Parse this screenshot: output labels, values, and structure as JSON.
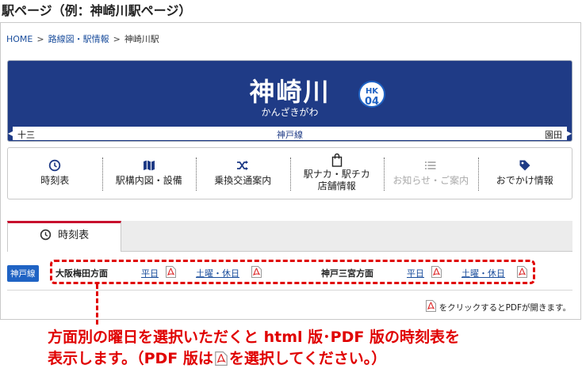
{
  "heading": "駅ページ（例：神崎川駅ページ）",
  "breadcrumb": {
    "home": "HOME",
    "sep": ">",
    "routes": "路線図・駅情報",
    "current": "神崎川駅"
  },
  "station": {
    "name": "神崎川",
    "kana": "かんざきがわ",
    "code_line": "HK",
    "code_num": "04",
    "prev": "十三",
    "line": "神戸線",
    "next": "園田"
  },
  "menu": [
    {
      "icon": "clock-icon",
      "label": "時刻表"
    },
    {
      "icon": "map-icon",
      "label": "駅構内図・設備"
    },
    {
      "icon": "shuffle-icon",
      "label": "乗換交通案内"
    },
    {
      "icon": "shopping-bag-icon",
      "label1": "駅ナカ・駅チカ",
      "label2": "店舗情報"
    },
    {
      "icon": "list-icon",
      "label": "お知らせ・ご案内",
      "disabled": true
    },
    {
      "icon": "tag-icon",
      "label": "おでかけ情報"
    }
  ],
  "tab": {
    "label": "時刻表",
    "icon": "clock-icon"
  },
  "timetable": {
    "line_tag": "神戸線",
    "dir1": "大阪梅田方面",
    "dir2": "神戸三宮方面",
    "weekday": "平日",
    "holiday": "土曜・休日"
  },
  "pdf_note": "をクリックするとPDFが開きます。",
  "caption": {
    "line1": "方面別の曜日を選択いただくと html 版･PDF 版の時刻表を",
    "line2a": "表示します。（PDF 版は",
    "line2b": "を選択してください。）"
  },
  "colors": {
    "header_bg": "#1f3b86",
    "accent_red": "#e00000",
    "link": "#1a4d9c",
    "line_tag": "#1f63c4"
  }
}
